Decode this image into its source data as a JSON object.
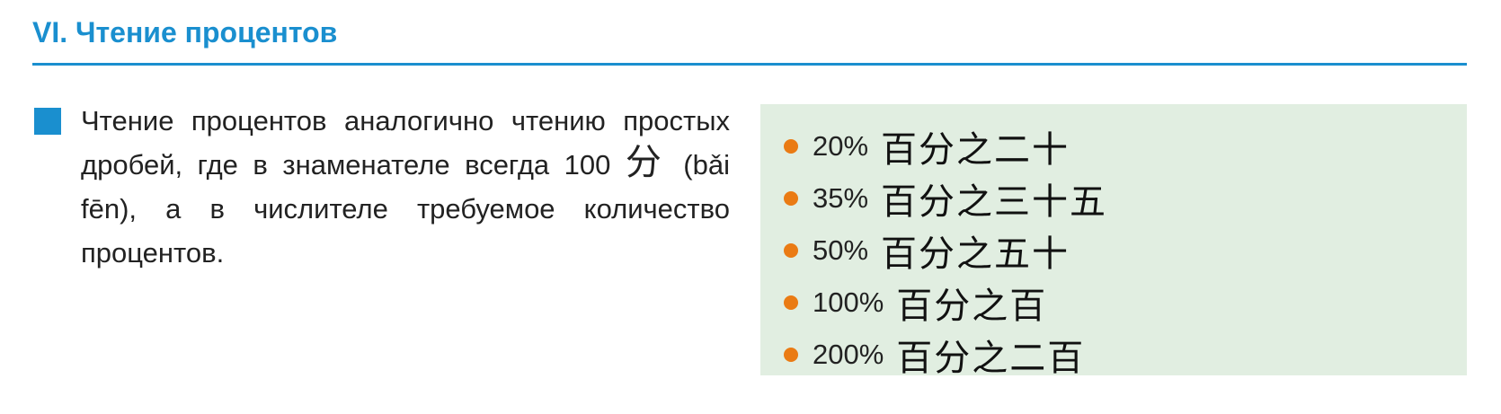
{
  "section": {
    "title": "VI. Чтение процентов"
  },
  "text": {
    "part1": "Чтение процентов аналогично чтению простых дробей, где в знаменателе всегда 100 ",
    "hanzi": "分",
    "part2": " (bǎi fēn), а в числителе требуемое количество процентов."
  },
  "examples": [
    {
      "percent": "20%",
      "chinese": "百分之二十"
    },
    {
      "percent": "35%",
      "chinese": "百分之三十五"
    },
    {
      "percent": "50%",
      "chinese": "百分之五十"
    },
    {
      "percent": "100%",
      "chinese": "百分之百"
    },
    {
      "percent": "200%",
      "chinese": "百分之二百"
    }
  ],
  "colors": {
    "accent": "#1a8fcf",
    "box_background": "#e1eee1",
    "bullet_dot": "#ea7b14"
  }
}
